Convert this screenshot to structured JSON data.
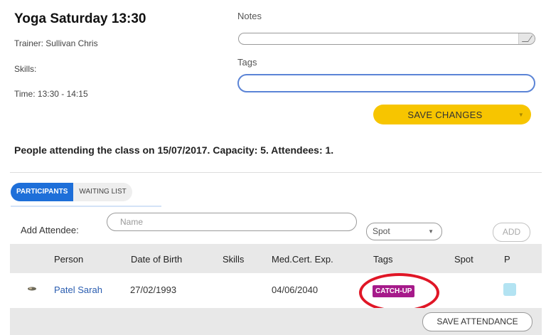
{
  "class_info": {
    "title": "Yoga Saturday 13:30",
    "trainer": "Trainer: Sullivan Chris",
    "skills": "Skills:",
    "time": "Time: 13:30 - 14:15"
  },
  "notes": {
    "label": "Notes",
    "value": ""
  },
  "tags": {
    "label": "Tags",
    "value": ""
  },
  "save_changes": {
    "label": "SAVE CHANGES",
    "caret_icon": "caret-down-icon",
    "color": "#f7c500"
  },
  "attending_summary": "People attending the class on 15/07/2017. Capacity: 5. Attendees: 1.",
  "tabs": [
    {
      "label": "PARTICIPANTS",
      "active": true
    },
    {
      "label": "WAITING LIST",
      "active": false
    }
  ],
  "add_attendee": {
    "label": "Add Attendee:",
    "name_placeholder": "Name",
    "spot_value": "Spot",
    "add_label": "ADD"
  },
  "table": {
    "headers": {
      "person": "Person",
      "dob": "Date of Birth",
      "skills": "Skills",
      "med_cert": "Med.Cert. Exp.",
      "tags": "Tags",
      "spot": "Spot",
      "present": "P"
    },
    "rows": [
      {
        "avatar_icon": "avatar-icon",
        "person": "Patel Sarah",
        "dob": "27/02/1993",
        "skills": "",
        "med_cert": "04/06/2040",
        "tag": "CATCH-UP",
        "spot": "",
        "present": false
      }
    ]
  },
  "save_attendance": {
    "label": "SAVE ATTENDANCE"
  },
  "colors": {
    "accent_blue": "#1e6fd9",
    "tag_badge": "#a61a8a",
    "highlight_ring": "#e01626",
    "present_checkbox": "#b3e3f2"
  }
}
